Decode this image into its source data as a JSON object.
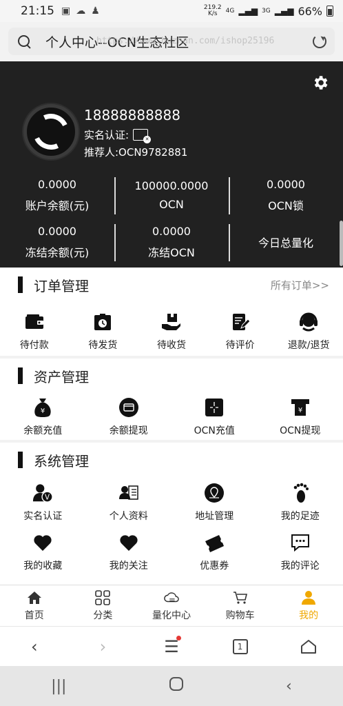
{
  "status": {
    "time": "21:15",
    "net_speed_top": "219.2",
    "net_speed_bottom": "K/s",
    "network": "4G",
    "network2": "3G",
    "battery": "66%"
  },
  "browser": {
    "title": "个人中心--OCN生态社区",
    "watermark": "https://www.huzhan.com/ishop25196",
    "tab_count": "1"
  },
  "profile": {
    "phone": "18888888888",
    "realname_label": "实名认证:",
    "referrer": "推荐人:OCN9782881",
    "stats_row1": [
      {
        "value": "0.0000",
        "label": "账户余额(元)"
      },
      {
        "value": "100000.0000",
        "label": "OCN"
      },
      {
        "value": "0.0000",
        "label": "OCN锁"
      }
    ],
    "stats_row2": [
      {
        "value": "0.0000",
        "label": "冻结余额(元)"
      },
      {
        "value": "0.0000",
        "label": "冻结OCN"
      },
      {
        "label": "今日总量化"
      }
    ]
  },
  "orders": {
    "title": "订单管理",
    "more": "所有订单>>",
    "items": [
      {
        "label": "待付款",
        "icon": "wallet-icon"
      },
      {
        "label": "待发货",
        "icon": "box-clock-icon"
      },
      {
        "label": "待收货",
        "icon": "hand-box-icon"
      },
      {
        "label": "待评价",
        "icon": "edit-doc-icon"
      },
      {
        "label": "退款/退货",
        "icon": "headset-icon"
      }
    ]
  },
  "assets": {
    "title": "资产管理",
    "items": [
      {
        "label": "余额充值",
        "icon": "money-bag-icon"
      },
      {
        "label": "余额提现",
        "icon": "card-icon"
      },
      {
        "label": "OCN充值",
        "icon": "ocn-icon"
      },
      {
        "label": "OCN提现",
        "icon": "atm-icon"
      }
    ]
  },
  "system": {
    "title": "系统管理",
    "row1": [
      {
        "label": "实名认证",
        "icon": "user-verify-icon"
      },
      {
        "label": "个人资料",
        "icon": "profile-card-icon"
      },
      {
        "label": "地址管理",
        "icon": "map-pin-icon"
      },
      {
        "label": "我的足迹",
        "icon": "footprint-icon"
      }
    ],
    "row2": [
      {
        "label": "我的收藏",
        "icon": "heart-icon"
      },
      {
        "label": "我的关注",
        "icon": "heart-icon"
      },
      {
        "label": "优惠券",
        "icon": "ticket-icon"
      },
      {
        "label": "我的评论",
        "icon": "comment-icon"
      }
    ]
  },
  "tabbar": [
    {
      "label": "首页",
      "icon": "home-icon"
    },
    {
      "label": "分类",
      "icon": "grid-icon"
    },
    {
      "label": "量化中心",
      "icon": "cloud-icon"
    },
    {
      "label": "购物车",
      "icon": "cart-icon"
    },
    {
      "label": "我的",
      "icon": "user-icon",
      "active": true
    }
  ],
  "colors": {
    "header_bg": "#212121",
    "active_tab": "#f0a800"
  }
}
